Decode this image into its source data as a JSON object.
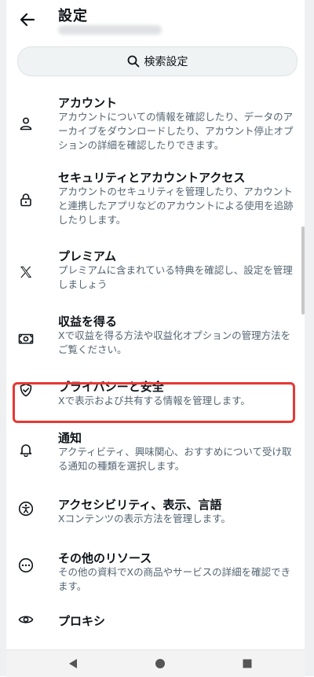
{
  "header": {
    "title": "設定"
  },
  "search": {
    "label": "検索設定"
  },
  "items": [
    {
      "label": "アカウント",
      "desc": "アカウントについての情報を確認したり、データのアーカイブをダウンロードしたり、アカウント停止オプションの詳細を確認したりできます。"
    },
    {
      "label": "セキュリティとアカウントアクセス",
      "desc": "アカウントのセキュリティを管理したり、アカウントと連携したアプリなどのアカウントによる使用を追跡したりします。"
    },
    {
      "label": "プレミアム",
      "desc": "プレミアムに含まれている特典を確認し、設定を管理しましょう"
    },
    {
      "label": "収益を得る",
      "desc": "Xで収益を得る方法や収益化オプションの管理方法をご覧ください。"
    },
    {
      "label": "プライバシーと安全",
      "desc": "Xで表示および共有する情報を管理します。"
    },
    {
      "label": "通知",
      "desc": "アクティビティ、興味関心、おすすめについて受け取る通知の種類を選択します。"
    },
    {
      "label": "アクセシビリティ、表示、言語",
      "desc": "Xコンテンツの表示方法を管理します。"
    },
    {
      "label": "その他のリソース",
      "desc": "その他の資料でXの商品やサービスの詳細を確認できます。"
    },
    {
      "label": "プロキシ",
      "desc": ""
    }
  ],
  "highlight_color": "#e53935"
}
